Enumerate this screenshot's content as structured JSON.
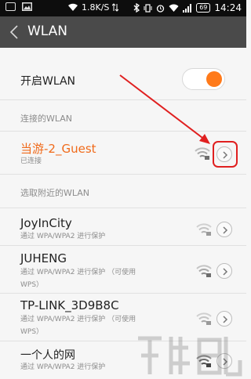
{
  "status_bar": {
    "speed": "1.8K/S",
    "battery": "69",
    "time": "14:24"
  },
  "action_bar": {
    "title": "WLAN",
    "back_icon": "back-icon"
  },
  "toggle": {
    "label": "开启WLAN",
    "state": "on",
    "color": "#ff7a1a"
  },
  "connected_section": {
    "header": "连接的WLAN",
    "network": {
      "name": "当游-2_Guest",
      "status": "已连接"
    }
  },
  "nearby_section": {
    "header": "选取附近的WLAN",
    "networks": [
      {
        "name": "JoyInCity",
        "security": "通过 WPA/WPA2 进行保护"
      },
      {
        "name": "JUHENG",
        "security": "通过 WPA/WPA2 进行保护 （可使用",
        "security2": "WPS）"
      },
      {
        "name": "TP-LINK_3D9B8C",
        "security": "通过 WPA/WPA2 进行保护 （可使用",
        "security2": "WPS）"
      },
      {
        "name": "一个人的网",
        "security": "通过 WPA/WPA2 进行保护"
      }
    ]
  },
  "colors": {
    "accent": "#f06a1a",
    "annotation": "#e02020",
    "action_bar": "#4a4a4a"
  }
}
